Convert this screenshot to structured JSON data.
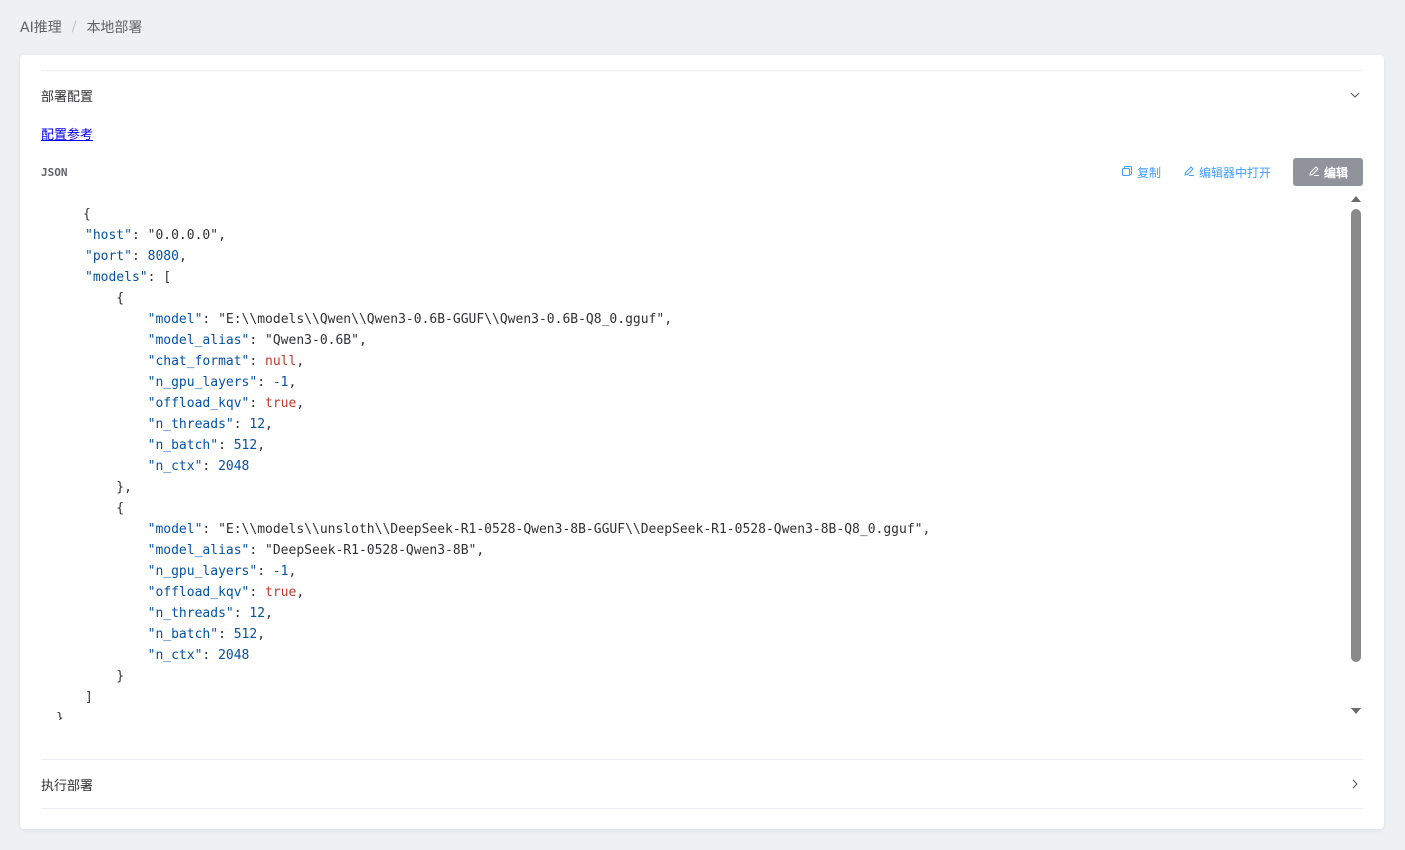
{
  "breadcrumb": {
    "root": "AI推理",
    "separator": "/",
    "current": "本地部署"
  },
  "deploy_config": {
    "title": "部署配置",
    "reference_link": "配置参考",
    "json_label": "JSON",
    "copy_label": "复制",
    "open_editor_label": "编辑器中打开",
    "edit_label": "编辑"
  },
  "execute": {
    "title": "执行部署"
  },
  "code_lines": [
    [
      [
        "p",
        "{"
      ]
    ],
    [
      [
        "k",
        "\"host\""
      ],
      [
        "p",
        ": "
      ],
      [
        "s",
        "\"0.0.0.0\""
      ],
      [
        "p",
        ","
      ]
    ],
    [
      [
        "k",
        "\"port\""
      ],
      [
        "p",
        ": "
      ],
      [
        "n",
        "8080"
      ],
      [
        "p",
        ","
      ]
    ],
    [
      [
        "k",
        "\"models\""
      ],
      [
        "p",
        ": ["
      ]
    ],
    [
      [
        "p",
        "    {"
      ]
    ],
    [
      [
        "p",
        "        "
      ],
      [
        "k",
        "\"model\""
      ],
      [
        "p",
        ": "
      ],
      [
        "s",
        "\"E:\\\\models\\\\Qwen\\\\Qwen3-0.6B-GGUF\\\\Qwen3-0.6B-Q8_0.gguf\""
      ],
      [
        "p",
        ","
      ]
    ],
    [
      [
        "p",
        "        "
      ],
      [
        "k",
        "\"model_alias\""
      ],
      [
        "p",
        ": "
      ],
      [
        "s",
        "\"Qwen3-0.6B\""
      ],
      [
        "p",
        ","
      ]
    ],
    [
      [
        "p",
        "        "
      ],
      [
        "k",
        "\"chat_format\""
      ],
      [
        "p",
        ": "
      ],
      [
        "b",
        "null"
      ],
      [
        "p",
        ","
      ]
    ],
    [
      [
        "p",
        "        "
      ],
      [
        "k",
        "\"n_gpu_layers\""
      ],
      [
        "p",
        ": "
      ],
      [
        "n",
        "-1"
      ],
      [
        "p",
        ","
      ]
    ],
    [
      [
        "p",
        "        "
      ],
      [
        "k",
        "\"offload_kqv\""
      ],
      [
        "p",
        ": "
      ],
      [
        "b",
        "true"
      ],
      [
        "p",
        ","
      ]
    ],
    [
      [
        "p",
        "        "
      ],
      [
        "k",
        "\"n_threads\""
      ],
      [
        "p",
        ": "
      ],
      [
        "n",
        "12"
      ],
      [
        "p",
        ","
      ]
    ],
    [
      [
        "p",
        "        "
      ],
      [
        "k",
        "\"n_batch\""
      ],
      [
        "p",
        ": "
      ],
      [
        "n",
        "512"
      ],
      [
        "p",
        ","
      ]
    ],
    [
      [
        "p",
        "        "
      ],
      [
        "k",
        "\"n_ctx\""
      ],
      [
        "p",
        ": "
      ],
      [
        "n",
        "2048"
      ]
    ],
    [
      [
        "p",
        "    },"
      ]
    ],
    [
      [
        "p",
        "    {"
      ]
    ],
    [
      [
        "p",
        "        "
      ],
      [
        "k",
        "\"model\""
      ],
      [
        "p",
        ": "
      ],
      [
        "s",
        "\"E:\\\\models\\\\unsloth\\\\DeepSeek-R1-0528-Qwen3-8B-GGUF\\\\DeepSeek-R1-0528-Qwen3-8B-Q8_0.gguf\""
      ],
      [
        "p",
        ","
      ]
    ],
    [
      [
        "p",
        "        "
      ],
      [
        "k",
        "\"model_alias\""
      ],
      [
        "p",
        ": "
      ],
      [
        "s",
        "\"DeepSeek-R1-0528-Qwen3-8B\""
      ],
      [
        "p",
        ","
      ]
    ],
    [
      [
        "p",
        "        "
      ],
      [
        "k",
        "\"n_gpu_layers\""
      ],
      [
        "p",
        ": "
      ],
      [
        "n",
        "-1"
      ],
      [
        "p",
        ","
      ]
    ],
    [
      [
        "p",
        "        "
      ],
      [
        "k",
        "\"offload_kqv\""
      ],
      [
        "p",
        ": "
      ],
      [
        "b",
        "true"
      ],
      [
        "p",
        ","
      ]
    ],
    [
      [
        "p",
        "        "
      ],
      [
        "k",
        "\"n_threads\""
      ],
      [
        "p",
        ": "
      ],
      [
        "n",
        "12"
      ],
      [
        "p",
        ","
      ]
    ],
    [
      [
        "p",
        "        "
      ],
      [
        "k",
        "\"n_batch\""
      ],
      [
        "p",
        ": "
      ],
      [
        "n",
        "512"
      ],
      [
        "p",
        ","
      ]
    ],
    [
      [
        "p",
        "        "
      ],
      [
        "k",
        "\"n_ctx\""
      ],
      [
        "p",
        ": "
      ],
      [
        "n",
        "2048"
      ]
    ],
    [
      [
        "p",
        "    }"
      ]
    ],
    [
      [
        "p",
        "]"
      ]
    ],
    [
      [
        "p",
        "}"
      ]
    ]
  ],
  "colors": {
    "accent": "#409eff",
    "key": "#0451a5",
    "literal": "#c0392b",
    "edit_button": "#909399"
  },
  "icons": {
    "expand_up": "chevron-down-icon",
    "expand_right": "chevron-right-icon",
    "copy": "copy-icon",
    "open": "edit-icon",
    "edit": "edit-icon"
  }
}
